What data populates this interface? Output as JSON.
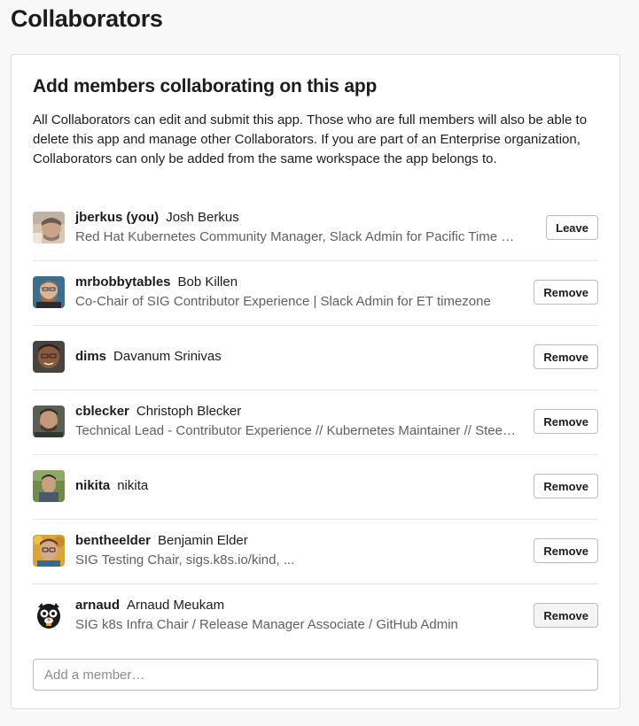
{
  "page": {
    "title": "Collaborators"
  },
  "card": {
    "heading": "Add members collaborating on this app",
    "description": "All Collaborators can edit and submit this app. Those who are full members will also be able to delete this app and manage other Collaborators. If you are part of an Enterprise organization, Collaborators can only be added from the same workspace the app belongs to."
  },
  "members": [
    {
      "username": "jberkus (you)",
      "real_name": "Josh Berkus",
      "title": "Red Hat Kubernetes Community Manager, Slack Admin for Pacific Time Zone",
      "action": "Leave"
    },
    {
      "username": "mrbobbytables",
      "real_name": "Bob Killen",
      "title": "Co-Chair of SIG Contributor Experience | Slack Admin for ET timezone",
      "action": "Remove"
    },
    {
      "username": "dims",
      "real_name": "Davanum Srinivas",
      "title": "",
      "action": "Remove"
    },
    {
      "username": "cblecker",
      "real_name": "Christoph Blecker",
      "title": "Technical Lead - Contributor Experience // Kubernetes Maintainer // Steeri...",
      "action": "Remove"
    },
    {
      "username": "nikita",
      "real_name": "nikita",
      "title": "",
      "action": "Remove"
    },
    {
      "username": "bentheelder",
      "real_name": "Benjamin Elder",
      "title": "SIG Testing Chair, sigs.k8s.io/kind, ...",
      "action": "Remove"
    },
    {
      "username": "arnaud",
      "real_name": "Arnaud Meukam",
      "title": "SIG k8s Infra Chair / Release Manager Associate / GitHub Admin",
      "action": "Remove"
    }
  ],
  "add_member": {
    "placeholder": "Add a member…"
  },
  "colors": {
    "text": "#1d1c1d",
    "muted": "#616061",
    "border": "#dddddd",
    "background": "#f8f8f8"
  }
}
